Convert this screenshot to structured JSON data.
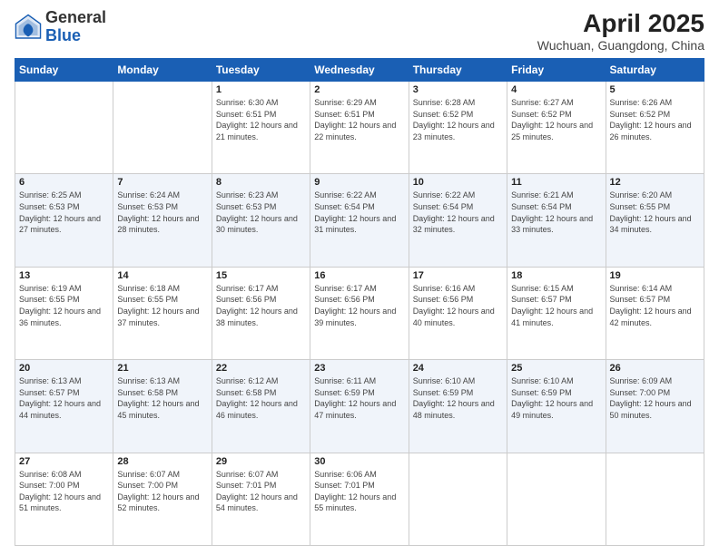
{
  "logo": {
    "text_general": "General",
    "text_blue": "Blue"
  },
  "header": {
    "title": "April 2025",
    "subtitle": "Wuchuan, Guangdong, China"
  },
  "days_of_week": [
    "Sunday",
    "Monday",
    "Tuesday",
    "Wednesday",
    "Thursday",
    "Friday",
    "Saturday"
  ],
  "weeks": [
    [
      {
        "day": "",
        "info": ""
      },
      {
        "day": "",
        "info": ""
      },
      {
        "day": "1",
        "info": "Sunrise: 6:30 AM\nSunset: 6:51 PM\nDaylight: 12 hours and 21 minutes."
      },
      {
        "day": "2",
        "info": "Sunrise: 6:29 AM\nSunset: 6:51 PM\nDaylight: 12 hours and 22 minutes."
      },
      {
        "day": "3",
        "info": "Sunrise: 6:28 AM\nSunset: 6:52 PM\nDaylight: 12 hours and 23 minutes."
      },
      {
        "day": "4",
        "info": "Sunrise: 6:27 AM\nSunset: 6:52 PM\nDaylight: 12 hours and 25 minutes."
      },
      {
        "day": "5",
        "info": "Sunrise: 6:26 AM\nSunset: 6:52 PM\nDaylight: 12 hours and 26 minutes."
      }
    ],
    [
      {
        "day": "6",
        "info": "Sunrise: 6:25 AM\nSunset: 6:53 PM\nDaylight: 12 hours and 27 minutes."
      },
      {
        "day": "7",
        "info": "Sunrise: 6:24 AM\nSunset: 6:53 PM\nDaylight: 12 hours and 28 minutes."
      },
      {
        "day": "8",
        "info": "Sunrise: 6:23 AM\nSunset: 6:53 PM\nDaylight: 12 hours and 30 minutes."
      },
      {
        "day": "9",
        "info": "Sunrise: 6:22 AM\nSunset: 6:54 PM\nDaylight: 12 hours and 31 minutes."
      },
      {
        "day": "10",
        "info": "Sunrise: 6:22 AM\nSunset: 6:54 PM\nDaylight: 12 hours and 32 minutes."
      },
      {
        "day": "11",
        "info": "Sunrise: 6:21 AM\nSunset: 6:54 PM\nDaylight: 12 hours and 33 minutes."
      },
      {
        "day": "12",
        "info": "Sunrise: 6:20 AM\nSunset: 6:55 PM\nDaylight: 12 hours and 34 minutes."
      }
    ],
    [
      {
        "day": "13",
        "info": "Sunrise: 6:19 AM\nSunset: 6:55 PM\nDaylight: 12 hours and 36 minutes."
      },
      {
        "day": "14",
        "info": "Sunrise: 6:18 AM\nSunset: 6:55 PM\nDaylight: 12 hours and 37 minutes."
      },
      {
        "day": "15",
        "info": "Sunrise: 6:17 AM\nSunset: 6:56 PM\nDaylight: 12 hours and 38 minutes."
      },
      {
        "day": "16",
        "info": "Sunrise: 6:17 AM\nSunset: 6:56 PM\nDaylight: 12 hours and 39 minutes."
      },
      {
        "day": "17",
        "info": "Sunrise: 6:16 AM\nSunset: 6:56 PM\nDaylight: 12 hours and 40 minutes."
      },
      {
        "day": "18",
        "info": "Sunrise: 6:15 AM\nSunset: 6:57 PM\nDaylight: 12 hours and 41 minutes."
      },
      {
        "day": "19",
        "info": "Sunrise: 6:14 AM\nSunset: 6:57 PM\nDaylight: 12 hours and 42 minutes."
      }
    ],
    [
      {
        "day": "20",
        "info": "Sunrise: 6:13 AM\nSunset: 6:57 PM\nDaylight: 12 hours and 44 minutes."
      },
      {
        "day": "21",
        "info": "Sunrise: 6:13 AM\nSunset: 6:58 PM\nDaylight: 12 hours and 45 minutes."
      },
      {
        "day": "22",
        "info": "Sunrise: 6:12 AM\nSunset: 6:58 PM\nDaylight: 12 hours and 46 minutes."
      },
      {
        "day": "23",
        "info": "Sunrise: 6:11 AM\nSunset: 6:59 PM\nDaylight: 12 hours and 47 minutes."
      },
      {
        "day": "24",
        "info": "Sunrise: 6:10 AM\nSunset: 6:59 PM\nDaylight: 12 hours and 48 minutes."
      },
      {
        "day": "25",
        "info": "Sunrise: 6:10 AM\nSunset: 6:59 PM\nDaylight: 12 hours and 49 minutes."
      },
      {
        "day": "26",
        "info": "Sunrise: 6:09 AM\nSunset: 7:00 PM\nDaylight: 12 hours and 50 minutes."
      }
    ],
    [
      {
        "day": "27",
        "info": "Sunrise: 6:08 AM\nSunset: 7:00 PM\nDaylight: 12 hours and 51 minutes."
      },
      {
        "day": "28",
        "info": "Sunrise: 6:07 AM\nSunset: 7:00 PM\nDaylight: 12 hours and 52 minutes."
      },
      {
        "day": "29",
        "info": "Sunrise: 6:07 AM\nSunset: 7:01 PM\nDaylight: 12 hours and 54 minutes."
      },
      {
        "day": "30",
        "info": "Sunrise: 6:06 AM\nSunset: 7:01 PM\nDaylight: 12 hours and 55 minutes."
      },
      {
        "day": "",
        "info": ""
      },
      {
        "day": "",
        "info": ""
      },
      {
        "day": "",
        "info": ""
      }
    ]
  ]
}
